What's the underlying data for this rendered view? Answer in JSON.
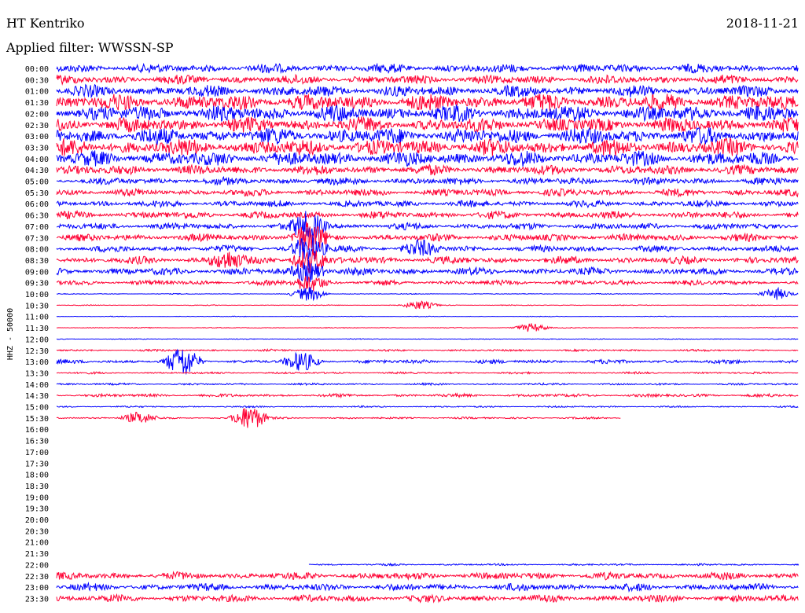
{
  "header": {
    "station": "HT Kentriko",
    "date": "2018-11-21",
    "filter": "Applied filter: WWSSN-SP"
  },
  "chart_data": {
    "type": "line",
    "title": "",
    "ylabel": "HHZ - 50000",
    "xlabel": "",
    "colors": [
      "#0000ff",
      "#ff0033"
    ],
    "rows": [
      {
        "label": "00:00",
        "amplitude": 0.55,
        "start": 0.0,
        "end": 1.0
      },
      {
        "label": "00:30",
        "amplitude": 0.55,
        "start": 0.0,
        "end": 1.0
      },
      {
        "label": "01:00",
        "amplitude": 0.7,
        "start": 0.0,
        "end": 1.0
      },
      {
        "label": "01:30",
        "amplitude": 1.0,
        "start": 0.0,
        "end": 1.0
      },
      {
        "label": "02:00",
        "amplitude": 1.0,
        "start": 0.0,
        "end": 1.0
      },
      {
        "label": "02:30",
        "amplitude": 0.9,
        "start": 0.0,
        "end": 1.0
      },
      {
        "label": "03:00",
        "amplitude": 1.0,
        "start": 0.0,
        "end": 1.0
      },
      {
        "label": "03:30",
        "amplitude": 1.0,
        "start": 0.0,
        "end": 1.0
      },
      {
        "label": "04:00",
        "amplitude": 0.9,
        "start": 0.0,
        "end": 1.0
      },
      {
        "label": "04:30",
        "amplitude": 0.6,
        "start": 0.0,
        "end": 1.0
      },
      {
        "label": "05:00",
        "amplitude": 0.45,
        "start": 0.0,
        "end": 1.0
      },
      {
        "label": "05:30",
        "amplitude": 0.45,
        "start": 0.0,
        "end": 1.0
      },
      {
        "label": "06:00",
        "amplitude": 0.4,
        "start": 0.0,
        "end": 1.0
      },
      {
        "label": "06:30",
        "amplitude": 0.45,
        "start": 0.0,
        "end": 1.0
      },
      {
        "label": "07:00",
        "amplitude": 0.4,
        "start": 0.0,
        "end": 1.0
      },
      {
        "label": "07:30",
        "amplitude": 0.45,
        "start": 0.0,
        "end": 1.0
      },
      {
        "label": "08:00",
        "amplitude": 0.4,
        "start": 0.0,
        "end": 1.0
      },
      {
        "label": "08:30",
        "amplitude": 0.45,
        "start": 0.0,
        "end": 1.0
      },
      {
        "label": "09:00",
        "amplitude": 0.45,
        "start": 0.0,
        "end": 1.0
      },
      {
        "label": "09:30",
        "amplitude": 0.3,
        "start": 0.0,
        "end": 1.0
      },
      {
        "label": "10:00",
        "amplitude": 0.05,
        "start": 0.0,
        "end": 1.0
      },
      {
        "label": "10:30",
        "amplitude": 0.05,
        "start": 0.0,
        "end": 1.0
      },
      {
        "label": "11:00",
        "amplitude": 0.04,
        "start": 0.0,
        "end": 1.0
      },
      {
        "label": "11:30",
        "amplitude": 0.05,
        "start": 0.0,
        "end": 1.0
      },
      {
        "label": "12:00",
        "amplitude": 0.05,
        "start": 0.0,
        "end": 1.0
      },
      {
        "label": "12:30",
        "amplitude": 0.12,
        "start": 0.0,
        "end": 1.0
      },
      {
        "label": "13:00",
        "amplitude": 0.25,
        "start": 0.0,
        "end": 1.0
      },
      {
        "label": "13:30",
        "amplitude": 0.12,
        "start": 0.0,
        "end": 1.0
      },
      {
        "label": "14:00",
        "amplitude": 0.12,
        "start": 0.0,
        "end": 1.0
      },
      {
        "label": "14:30",
        "amplitude": 0.2,
        "start": 0.0,
        "end": 1.0
      },
      {
        "label": "15:00",
        "amplitude": 0.1,
        "start": 0.0,
        "end": 1.0
      },
      {
        "label": "15:30",
        "amplitude": 0.12,
        "start": 0.0,
        "end": 0.76
      },
      {
        "label": "16:00",
        "amplitude": 0,
        "start": 0,
        "end": 0
      },
      {
        "label": "16:30",
        "amplitude": 0,
        "start": 0,
        "end": 0
      },
      {
        "label": "17:00",
        "amplitude": 0,
        "start": 0,
        "end": 0
      },
      {
        "label": "17:30",
        "amplitude": 0,
        "start": 0,
        "end": 0
      },
      {
        "label": "18:00",
        "amplitude": 0,
        "start": 0,
        "end": 0
      },
      {
        "label": "18:30",
        "amplitude": 0,
        "start": 0,
        "end": 0
      },
      {
        "label": "19:00",
        "amplitude": 0,
        "start": 0,
        "end": 0
      },
      {
        "label": "19:30",
        "amplitude": 0,
        "start": 0,
        "end": 0
      },
      {
        "label": "20:00",
        "amplitude": 0,
        "start": 0,
        "end": 0
      },
      {
        "label": "20:30",
        "amplitude": 0,
        "start": 0,
        "end": 0
      },
      {
        "label": "21:00",
        "amplitude": 0,
        "start": 0,
        "end": 0
      },
      {
        "label": "21:30",
        "amplitude": 0,
        "start": 0,
        "end": 0
      },
      {
        "label": "22:00",
        "amplitude": 0.12,
        "start": 0.34,
        "end": 1.0
      },
      {
        "label": "22:30",
        "amplitude": 0.45,
        "start": 0.0,
        "end": 1.0
      },
      {
        "label": "23:00",
        "amplitude": 0.45,
        "start": 0.0,
        "end": 1.0
      },
      {
        "label": "23:30",
        "amplitude": 0.45,
        "start": 0.0,
        "end": 1.0
      }
    ],
    "events": [
      {
        "row": "07:00",
        "x": 0.34,
        "strength": 1.0
      },
      {
        "row": "07:30",
        "x": 0.34,
        "strength": 1.0
      },
      {
        "row": "08:00",
        "x": 0.34,
        "strength": 0.9
      },
      {
        "row": "08:00",
        "x": 0.49,
        "strength": 0.5
      },
      {
        "row": "08:30",
        "x": 0.23,
        "strength": 0.6
      },
      {
        "row": "08:30",
        "x": 0.34,
        "strength": 0.8
      },
      {
        "row": "09:00",
        "x": 0.34,
        "strength": 0.7
      },
      {
        "row": "09:30",
        "x": 0.34,
        "strength": 0.6
      },
      {
        "row": "10:00",
        "x": 0.34,
        "strength": 0.5
      },
      {
        "row": "10:00",
        "x": 0.97,
        "strength": 0.4
      },
      {
        "row": "10:30",
        "x": 0.49,
        "strength": 0.3
      },
      {
        "row": "11:30",
        "x": 0.64,
        "strength": 0.3
      },
      {
        "row": "13:00",
        "x": 0.17,
        "strength": 1.0
      },
      {
        "row": "13:00",
        "x": 0.33,
        "strength": 0.6
      },
      {
        "row": "15:30",
        "x": 0.26,
        "strength": 0.9
      },
      {
        "row": "15:30",
        "x": 0.11,
        "strength": 0.4
      }
    ]
  }
}
